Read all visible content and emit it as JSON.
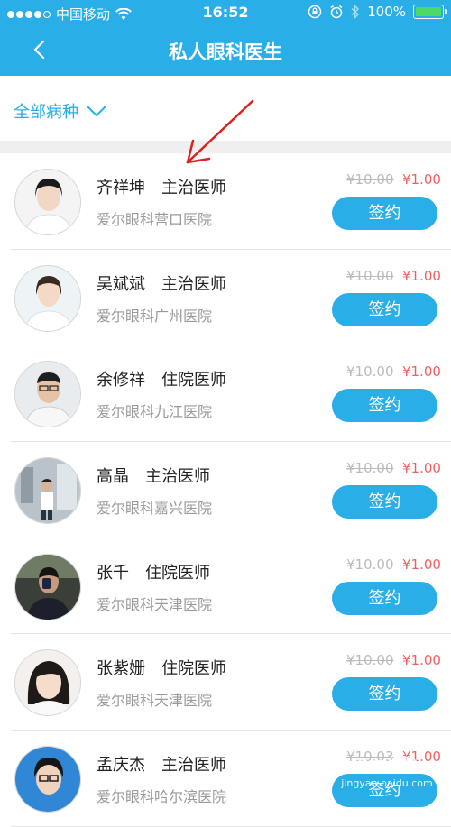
{
  "status_bar": {
    "carrier": "中国移动",
    "time": "16:52",
    "battery": "100%",
    "signal_icon": "signal-dots-icon",
    "wifi_icon": "wifi-icon"
  },
  "nav": {
    "title": "私人眼科医生",
    "back_icon": "chevron-left-icon"
  },
  "filter": {
    "label": "全部病种",
    "icon": "chevron-down-icon"
  },
  "doctors": [
    {
      "name": "齐祥坤",
      "title": "主治医师",
      "hospital": "爱尔眼科营口医院",
      "price_old": "¥10.00",
      "price_new": "¥1.00",
      "button": "签约"
    },
    {
      "name": "吴斌斌",
      "title": "主治医师",
      "hospital": "爱尔眼科广州医院",
      "price_old": "¥10.00",
      "price_new": "¥1.00",
      "button": "签约"
    },
    {
      "name": "余修祥",
      "title": "住院医师",
      "hospital": "爱尔眼科九江医院",
      "price_old": "¥10.00",
      "price_new": "¥1.00",
      "button": "签约"
    },
    {
      "name": "高晶",
      "title": "主治医师",
      "hospital": "爱尔眼科嘉兴医院",
      "price_old": "¥10.00",
      "price_new": "¥1.00",
      "button": "签约"
    },
    {
      "name": "张千",
      "title": "住院医师",
      "hospital": "爱尔眼科天津医院",
      "price_old": "¥10.00",
      "price_new": "¥1.00",
      "button": "签约"
    },
    {
      "name": "张紫姗",
      "title": "住院医师",
      "hospital": "爱尔眼科天津医院",
      "price_old": "¥10.00",
      "price_new": "¥1.00",
      "button": "签约"
    },
    {
      "name": "孟庆杰",
      "title": "主治医师",
      "hospital": "爱尔眼科哈尔滨医院",
      "price_old": "¥10.03",
      "price_new": "¥1.00",
      "button": "签约"
    }
  ],
  "colors": {
    "accent": "#29aee8",
    "price": "#f35f5f",
    "annotation": "#e02020"
  },
  "watermark": {
    "line1": "Bai 经验",
    "line2": "jingyan.baidu.com"
  }
}
